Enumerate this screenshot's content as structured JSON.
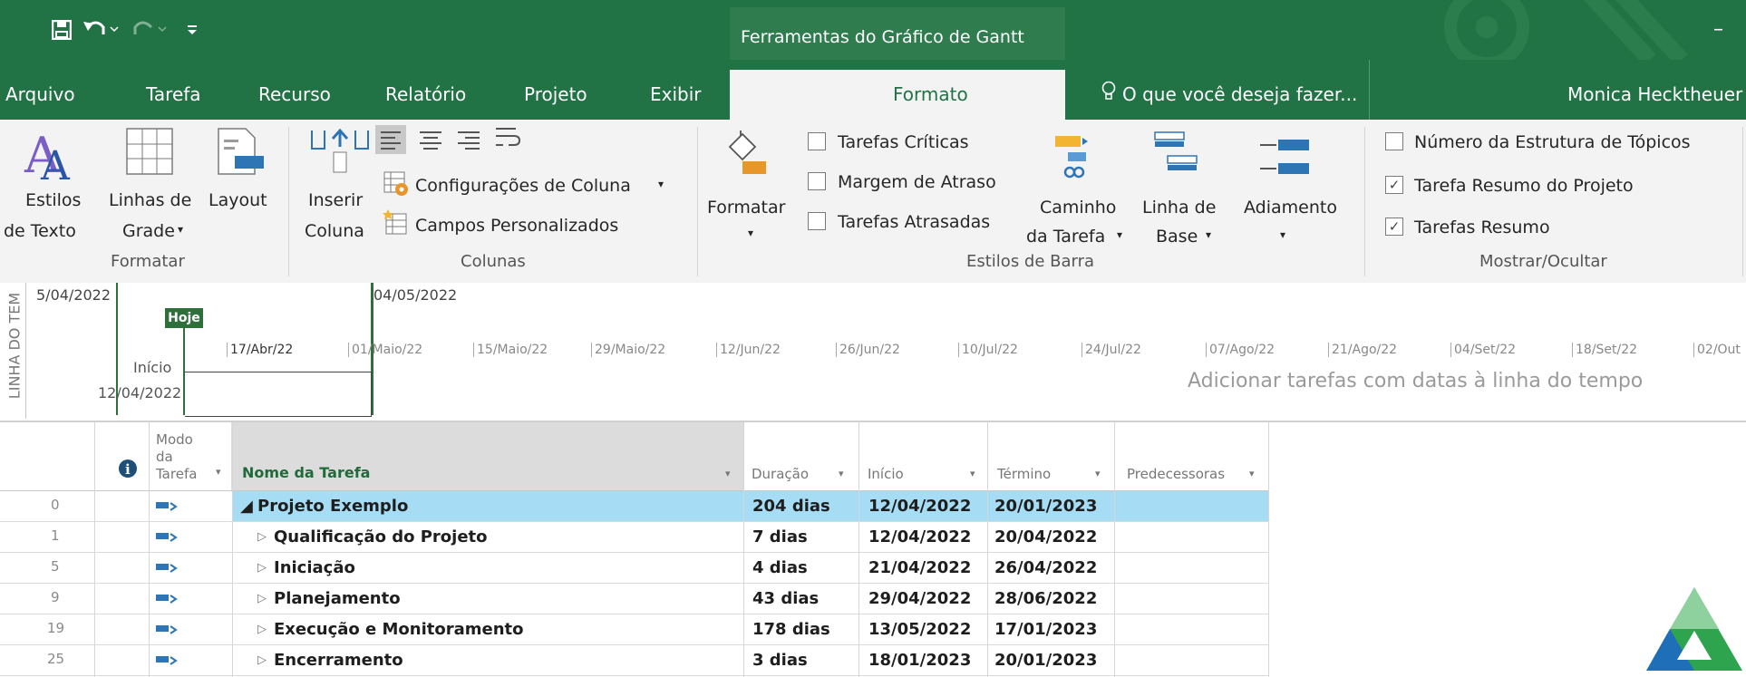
{
  "quick_access": {
    "save_icon": "save-icon",
    "undo_icon": "undo-icon",
    "redo_icon": "redo-icon",
    "customize_icon": "customize-icon"
  },
  "title_bar": {
    "context_header": "Ferramentas do Gráfico de Gantt",
    "minimize": "–"
  },
  "tabs": [
    "Arquivo",
    "Tarefa",
    "Recurso",
    "Relatório",
    "Projeto",
    "Exibir",
    "Formato"
  ],
  "tell_me": "O que você deseja fazer...",
  "user": "Monica Hecktheuer",
  "ribbon": {
    "formatar_group": {
      "label": "Formatar",
      "estilos_1": "Estilos",
      "estilos_2": "de Texto",
      "linhas_1": "Linhas de",
      "linhas_2": "Grade",
      "layout": "Layout"
    },
    "colunas_group": {
      "label": "Colunas",
      "inserir_1": "Inserir",
      "inserir_2": "Coluna",
      "config": "Configurações de Coluna",
      "campos": "Campos Personalizados"
    },
    "estilos_barra_group": {
      "label": "Estilos de Barra",
      "formatar": "Formatar",
      "tarefas_criticas": "Tarefas Críticas",
      "margem_atraso": "Margem de Atraso",
      "tarefas_atrasadas": "Tarefas Atrasadas",
      "caminho_1": "Caminho",
      "caminho_2": "da Tarefa",
      "linha_base_1": "Linha de",
      "linha_base_2": "Base",
      "adiamento": "Adiamento"
    },
    "mostrar_group": {
      "label": "Mostrar/Ocultar",
      "numero_estrutura": "Número da Estrutura de Tópicos",
      "tarefa_resumo_projeto": "Tarefa Resumo do Projeto",
      "tarefas_resumo": "Tarefas Resumo",
      "checked": [
        false,
        true,
        true
      ]
    }
  },
  "timeline": {
    "side_label": "LINHA DO TEM",
    "start_partial": "5/04/2022",
    "today_label": "Hoje",
    "end_date": "04/05/2022",
    "inicio_label": "Início",
    "inicio_date": "12/04/2022",
    "ticks": [
      "17/Abr/22",
      "01/Maio/22",
      "15/Maio/22",
      "29/Maio/22",
      "12/Jun/22",
      "26/Jun/22",
      "10/Jul/22",
      "24/Jul/22",
      "07/Ago/22",
      "21/Ago/22",
      "04/Set/22",
      "18/Set/22",
      "02/Out"
    ],
    "placeholder": "Adicionar tarefas com datas à linha do tempo"
  },
  "grid": {
    "headers": {
      "info": "i",
      "modo_1": "Modo",
      "modo_2": "da",
      "modo_3": "Tarefa",
      "nome": "Nome da Tarefa",
      "duracao": "Duração",
      "inicio": "Início",
      "termino": "Término",
      "predecessoras": "Predecessoras"
    },
    "rows": [
      {
        "id": "0",
        "name": "Projeto Exemplo",
        "duration": "204 dias",
        "start": "12/04/2022",
        "end": "20/01/2023",
        "summary": true
      },
      {
        "id": "1",
        "name": "Qualificação do Projeto",
        "duration": "7 dias",
        "start": "12/04/2022",
        "end": "20/04/2022"
      },
      {
        "id": "5",
        "name": "Iniciação",
        "duration": "4 dias",
        "start": "21/04/2022",
        "end": "26/04/2022"
      },
      {
        "id": "9",
        "name": "Planejamento",
        "duration": "43 dias",
        "start": "29/04/2022",
        "end": "28/06/2022"
      },
      {
        "id": "19",
        "name": "Execução e Monitoramento",
        "duration": "178 dias",
        "start": "13/05/2022",
        "end": "17/01/2023"
      },
      {
        "id": "25",
        "name": "Encerramento",
        "duration": "3 dias",
        "start": "18/01/2023",
        "end": "20/01/2023"
      }
    ]
  },
  "colors": {
    "accent": "#217346",
    "selected_row": "#a6dcf4",
    "timeline_green": "#2f6f3b"
  }
}
